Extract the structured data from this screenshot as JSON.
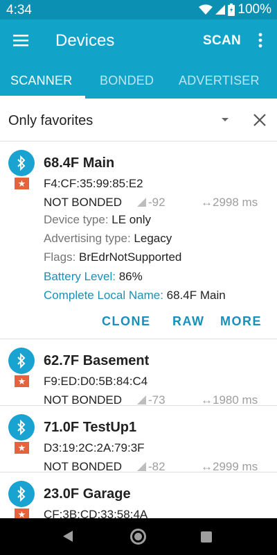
{
  "status_bar": {
    "time": "4:34",
    "battery_percent": "100%"
  },
  "app_bar": {
    "title": "Devices",
    "scan_label": "SCAN"
  },
  "tabs": [
    {
      "label": "SCANNER",
      "active": true
    },
    {
      "label": "BONDED",
      "active": false
    },
    {
      "label": "ADVERTISER",
      "active": false
    }
  ],
  "filter": {
    "label": "Only favorites"
  },
  "devices": [
    {
      "name": "68.4F Main",
      "mac": "F4:CF:35:99:85:E2",
      "bond_state": "NOT BONDED",
      "rssi": "-92",
      "interval": "2998 ms",
      "details": {
        "device_type_key": "Device type:",
        "device_type_val": "LE only",
        "adv_type_key": "Advertising type:",
        "adv_type_val": "Legacy",
        "flags_key": "Flags:",
        "flags_val": "BrEdrNotSupported",
        "battery_key": "Battery Level:",
        "battery_val": "86%",
        "local_name_key": "Complete Local Name:",
        "local_name_val": "68.4F Main"
      },
      "actions": {
        "clone": "CLONE",
        "raw": "RAW",
        "more": "MORE"
      }
    },
    {
      "name": "62.7F Basement",
      "mac": "F9:ED:D0:5B:84:C4",
      "bond_state": "NOT BONDED",
      "rssi": "-73",
      "interval": "1980 ms"
    },
    {
      "name": "71.0F TestUp1",
      "mac": "D3:19:2C:2A:79:3F",
      "bond_state": "NOT BONDED",
      "rssi": "-82",
      "interval": "2999 ms"
    },
    {
      "name": "23.0F Garage",
      "mac": "CF:3B:CD:33:58:4A"
    }
  ],
  "icons": {
    "menu": "hamburger-icon",
    "overflow": "more-vert-icon",
    "dropdown": "caret-down-icon",
    "clear": "close-icon",
    "device": "bluetooth-icon",
    "favorite": "star-icon",
    "signal": "signal-icon",
    "interval": "left-right-arrow-icon"
  },
  "colors": {
    "status_bar": "#0b8fb3",
    "primary": "#12a3c9",
    "accent": "#1a8fb8",
    "favorite_badge": "#e5633b",
    "nav_bar": "#000000"
  }
}
